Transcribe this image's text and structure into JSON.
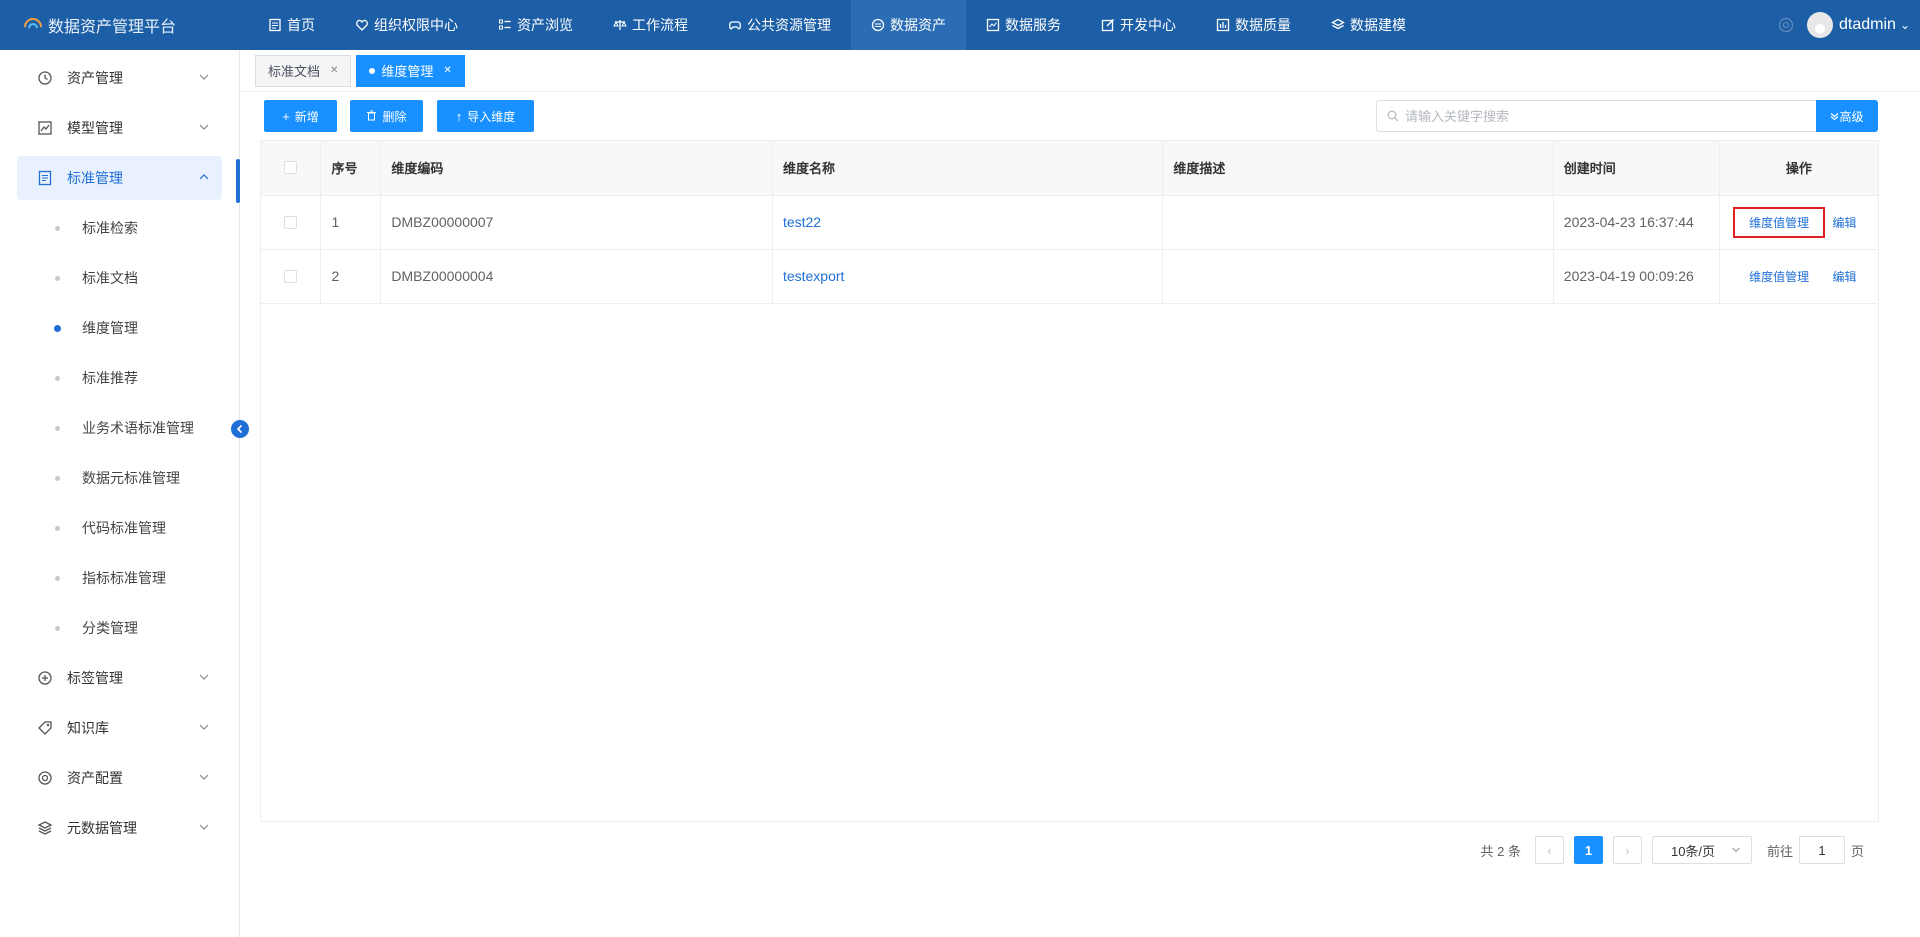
{
  "app": {
    "title": "数据资产管理平台"
  },
  "nav": [
    {
      "label": "首页",
      "icon": "document-icon"
    },
    {
      "label": "组织权限中心",
      "icon": "heart-shield-icon"
    },
    {
      "label": "资产浏览",
      "icon": "list-icon"
    },
    {
      "label": "工作流程",
      "icon": "scale-icon"
    },
    {
      "label": "公共资源管理",
      "icon": "gamepad-icon"
    },
    {
      "label": "数据资产",
      "icon": "data-asset-icon",
      "active": true
    },
    {
      "label": "数据服务",
      "icon": "chart-box-icon"
    },
    {
      "label": "开发中心",
      "icon": "edit-icon"
    },
    {
      "label": "数据质量",
      "icon": "bar-chart-icon"
    },
    {
      "label": "数据建模",
      "icon": "layers-icon"
    }
  ],
  "user": {
    "name": "dtadmin"
  },
  "sidebar": {
    "items": [
      {
        "label": "资产管理",
        "icon": "clock-icon"
      },
      {
        "label": "模型管理",
        "icon": "line-chart-icon"
      },
      {
        "label": "标准管理",
        "icon": "doc-list-icon",
        "active": true,
        "children": [
          {
            "label": "标准检索"
          },
          {
            "label": "标准文档"
          },
          {
            "label": "维度管理",
            "active": true
          },
          {
            "label": "标准推荐"
          },
          {
            "label": "业务术语标准管理"
          },
          {
            "label": "数据元标准管理"
          },
          {
            "label": "代码标准管理"
          },
          {
            "label": "指标标准管理"
          },
          {
            "label": "分类管理"
          }
        ]
      },
      {
        "label": "标签管理",
        "icon": "plus-circle-icon"
      },
      {
        "label": "知识库",
        "icon": "tag-icon"
      },
      {
        "label": "资产配置",
        "icon": "target-icon"
      },
      {
        "label": "元数据管理",
        "icon": "stack-icon"
      }
    ]
  },
  "tabs": [
    {
      "label": "标准文档",
      "active": false
    },
    {
      "label": "维度管理",
      "active": true
    }
  ],
  "toolbar": {
    "add_label": "新增",
    "delete_label": "删除",
    "import_label": "导入维度",
    "search_placeholder": "请输入关键字搜索",
    "advanced_label": "高级"
  },
  "table": {
    "columns": [
      "序号",
      "维度编码",
      "维度名称",
      "维度描述",
      "创建时间",
      "操作"
    ],
    "rows": [
      {
        "index": "1",
        "code": "DMBZ00000007",
        "name": "test22",
        "desc": "",
        "created": "2023-04-23 16:37:44"
      },
      {
        "index": "2",
        "code": "DMBZ00000004",
        "name": "testexport",
        "desc": "",
        "created": "2023-04-19 00:09:26"
      }
    ],
    "actions": {
      "manage": "维度值管理",
      "edit": "编辑"
    }
  },
  "pagination": {
    "total_text": "共 2 条",
    "current_page": "1",
    "page_size": "10条/页",
    "goto_prefix": "前往",
    "goto_value": "1",
    "goto_suffix": "页"
  },
  "colors": {
    "topbar": "#1d5fa6",
    "accent": "#1890ff",
    "highlight": "#e02020"
  }
}
